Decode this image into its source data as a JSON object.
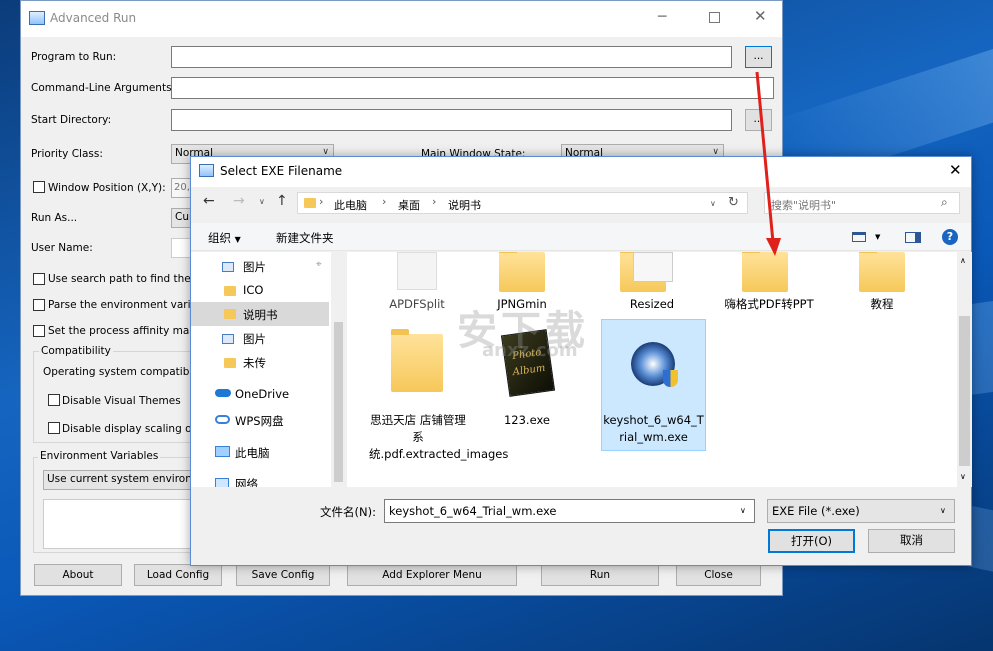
{
  "main_window": {
    "title": "Advanced Run",
    "labels": {
      "program": "Program to Run:",
      "args": "Command-Line Arguments:",
      "startdir": "Start Directory:",
      "priority": "Priority Class:",
      "window_state": "Main Window State:",
      "window_pos": "Window Position (X,Y):",
      "run_as": "Run As...",
      "user_name": "User Name:",
      "search_path": "Use search path to find the pr",
      "parse_env": "Parse the environment variab",
      "affinity": "Set the process affinity mask",
      "compat_group": "Compatibility",
      "os_compat": "Operating system compatibility",
      "visual_themes": "Disable Visual Themes",
      "display_scaling": "Disable display scaling on h",
      "env_group": "Environment Variables"
    },
    "values": {
      "priority": "Normal",
      "window_state": "Normal",
      "window_pos": "20,",
      "run_as": "Cur",
      "env": "Use current system environme"
    },
    "browse_label": "...",
    "buttons": {
      "about": "About",
      "load": "Load Config",
      "save": "Save Config",
      "explorer": "Add Explorer Menu",
      "run": "Run",
      "close": "Close"
    }
  },
  "dialog": {
    "title": "Select EXE Filename",
    "breadcrumb": [
      "此电脑",
      "桌面",
      "说明书"
    ],
    "search_placeholder": "搜索\"说明书\"",
    "toolbar": {
      "organize": "组织",
      "new_folder": "新建文件夹"
    },
    "nav": [
      "图片",
      "ICO",
      "说明书",
      "图片",
      "未传",
      "OneDrive",
      "WPS网盘",
      "此电脑",
      "网络"
    ],
    "files_top": [
      "APDFSplit",
      "JPNGmin",
      "Resized",
      "嗨格式PDF转PPT",
      "教程"
    ],
    "files_bottom": [
      {
        "name": "思迅天店 店铺管理系统.pdf.extracted_images"
      },
      {
        "name": "123.exe",
        "art": "Photo Album"
      },
      {
        "name": "keyshot_6_w64_Trial_wm.exe"
      }
    ],
    "filename_label": "文件名(N):",
    "filename_value": "keyshot_6_w64_Trial_wm.exe",
    "filter": "EXE File (*.exe)",
    "open": "打开(O)",
    "cancel": "取消"
  },
  "watermark": {
    "cn": "安下载",
    "en": "anxz.com"
  },
  "colors": {
    "accent": "#0078d7",
    "selection": "#cce8ff",
    "arrow": "#e0201a"
  }
}
